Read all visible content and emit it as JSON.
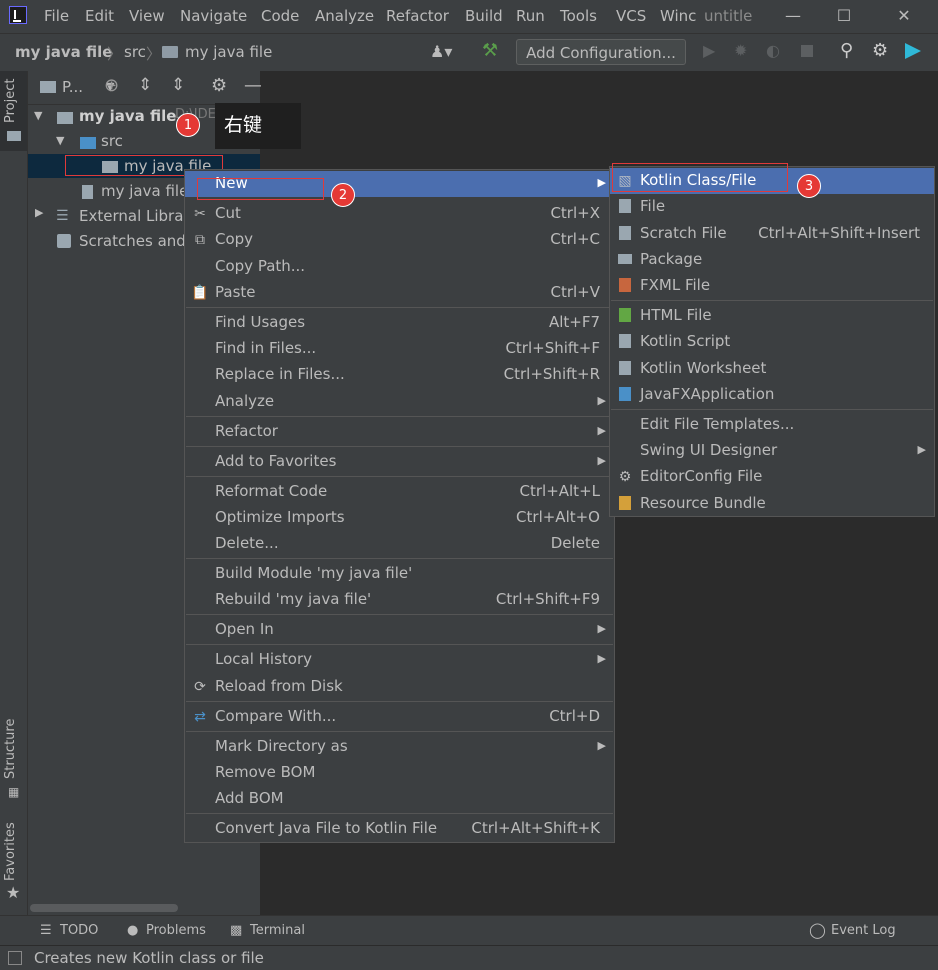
{
  "menubar": {
    "items": [
      "File",
      "Edit",
      "View",
      "Navigate",
      "Code",
      "Analyze",
      "Refactor",
      "Build",
      "Run",
      "Tools",
      "VCS",
      "Winc"
    ],
    "window_title": "untitle"
  },
  "navbar": {
    "crumbs": [
      "my java file",
      "src",
      "my java file"
    ],
    "add_configuration": "Add Configuration..."
  },
  "left_strip": {
    "tabs": [
      "Project",
      "Structure",
      "Favorites"
    ]
  },
  "project_panel": {
    "header": "P...",
    "tree": {
      "root": "my java file",
      "root_path": "D:\\IDEA",
      "src": "src",
      "folder": "my java file",
      "file": "my java file.",
      "external": "External Librar",
      "scratches": "Scratches and"
    }
  },
  "callout": {
    "text": "右键",
    "badge1": "1",
    "badge2": "2",
    "badge3": "3"
  },
  "context_menu": {
    "new": "New",
    "cut": "Cut",
    "cut_sc": "Ctrl+X",
    "copy": "Copy",
    "copy_sc": "Ctrl+C",
    "copy_path": "Copy Path...",
    "paste": "Paste",
    "paste_sc": "Ctrl+V",
    "find_usages": "Find Usages",
    "find_usages_sc": "Alt+F7",
    "find_in_files": "Find in Files...",
    "find_in_files_sc": "Ctrl+Shift+F",
    "replace_in_files": "Replace in Files...",
    "replace_in_files_sc": "Ctrl+Shift+R",
    "analyze": "Analyze",
    "refactor": "Refactor",
    "add_to_favorites": "Add to Favorites",
    "reformat_code": "Reformat Code",
    "reformat_code_sc": "Ctrl+Alt+L",
    "optimize_imports": "Optimize Imports",
    "optimize_imports_sc": "Ctrl+Alt+O",
    "delete": "Delete...",
    "delete_sc": "Delete",
    "build_module": "Build Module 'my java file'",
    "rebuild": "Rebuild 'my java file'",
    "rebuild_sc": "Ctrl+Shift+F9",
    "open_in": "Open In",
    "local_history": "Local History",
    "reload_from_disk": "Reload from Disk",
    "compare_with": "Compare With...",
    "compare_with_sc": "Ctrl+D",
    "mark_directory_as": "Mark Directory as",
    "remove_bom": "Remove BOM",
    "add_bom": "Add BOM",
    "convert_java": "Convert Java File to Kotlin File",
    "convert_java_sc": "Ctrl+Alt+Shift+K"
  },
  "submenu": {
    "kotlin_class": "Kotlin Class/File",
    "file": "File",
    "scratch_file": "Scratch File",
    "scratch_file_sc": "Ctrl+Alt+Shift+Insert",
    "package": "Package",
    "fxml_file": "FXML File",
    "html_file": "HTML File",
    "kotlin_script": "Kotlin Script",
    "kotlin_worksheet": "Kotlin Worksheet",
    "javafx_app": "JavaFXApplication",
    "edit_templates": "Edit File Templates...",
    "swing_designer": "Swing UI Designer",
    "editorconfig": "EditorConfig File",
    "resource_bundle": "Resource Bundle"
  },
  "bottom": {
    "todo": "TODO",
    "problems": "Problems",
    "terminal": "Terminal",
    "event_log": "Event Log",
    "status": "Creates new Kotlin class or file"
  }
}
